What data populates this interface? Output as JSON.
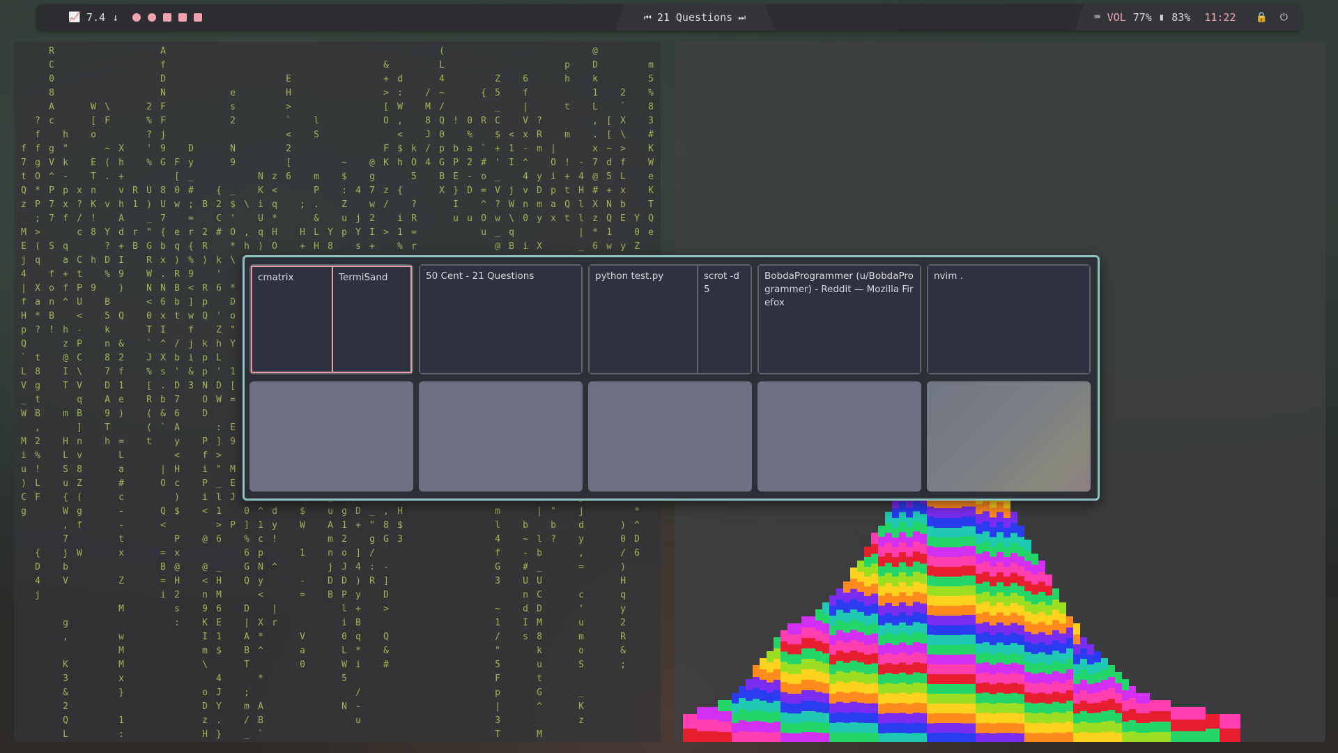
{
  "topbar": {
    "cpu_load": "7.4",
    "cpu_arrow": "↓",
    "now_playing": "21 Questions",
    "prev_icon": "⏮",
    "next_icon": "⏭",
    "volume_label": "VOL",
    "volume_value": "77%",
    "battery_value": "83%",
    "clock": "11:22"
  },
  "overview": {
    "workspaces": [
      {
        "windows": [
          {
            "title": "cmatrix",
            "active": true
          },
          {
            "title": "TermiSand",
            "active": true
          }
        ]
      },
      {
        "windows": [
          {
            "title": "50 Cent - 21 Questions"
          }
        ]
      },
      {
        "windows": [
          {
            "title": "python test.py"
          },
          {
            "title": "scrot -d 5"
          }
        ]
      },
      {
        "windows": [
          {
            "title": "BobdaProgrammer (u/BobdaProgrammer) - Reddit — Mozilla Firefox"
          }
        ]
      },
      {
        "windows": [
          {
            "title": "nvim ."
          }
        ]
      }
    ]
  },
  "colors": {
    "accent_pink": "#f0a2ad",
    "overview_border": "#8fc5c0",
    "matrix_green": "#b9c95a"
  },
  "icons": [
    "chart-icon",
    "keyboard-icon",
    "battery-icon",
    "lock-icon",
    "power-icon",
    "prev-track-icon",
    "next-track-icon"
  ]
}
